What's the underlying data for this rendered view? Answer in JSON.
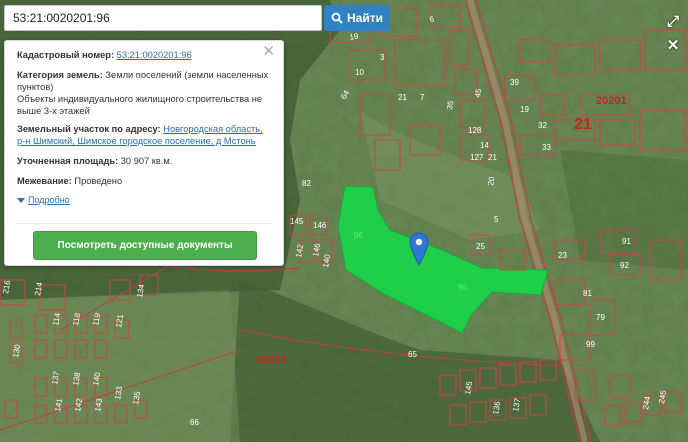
{
  "search": {
    "value": "53:21:0020201:96",
    "button_label": "Найти",
    "icon": "search-icon"
  },
  "map_controls": {
    "expand_icon": "expand-icon",
    "close_icon": "close-icon"
  },
  "info": {
    "cadastral_label": "Кадастровый номер:",
    "cadastral_value": "53:21:0020201:96",
    "category_label": "Категория земель:",
    "category_value": "Земли поселений (земли населенных пунктов)",
    "usage": "Объекты индивидуального жилищного строительства не выше 3-х этажей",
    "address_label": "Земельный участок по адресу:",
    "address_value": "Новгородская область, р-н Шимский, Шимское городское поселение, д Мстонь",
    "area_label": "Уточненная площадь:",
    "area_value": "30 907 кв.м.",
    "survey_label": "Межевание:",
    "survey_value": "Проведено",
    "more_label": "Подробно",
    "docs_button": "Посмотреть доступные документы"
  },
  "map": {
    "quarter_labels": [
      "20201",
      "21",
      "20201"
    ],
    "parcel_labels": [
      "19",
      "10",
      "3",
      "6",
      "21",
      "7",
      "35",
      "45",
      "64",
      "39",
      "19",
      "128",
      "14",
      "127",
      "33",
      "32",
      "21",
      "82",
      "20",
      "5",
      "91",
      "25",
      "23",
      "92",
      "81",
      "79",
      "99",
      "145",
      "146",
      "142",
      "146",
      "140",
      "134",
      "65",
      "66",
      "114",
      "118",
      "119",
      "121",
      "130",
      "133",
      "135",
      "136",
      "137",
      "145",
      "244",
      "245",
      "216",
      "214",
      "137",
      "138",
      "140",
      "141",
      "142",
      "143"
    ],
    "parcel_inner_label": "96",
    "colors": {
      "parcel_fill": "#1fcf4a",
      "parcel_line": "#b02a2a",
      "pin": "#2d78d2",
      "road": "#c85a3a"
    }
  }
}
